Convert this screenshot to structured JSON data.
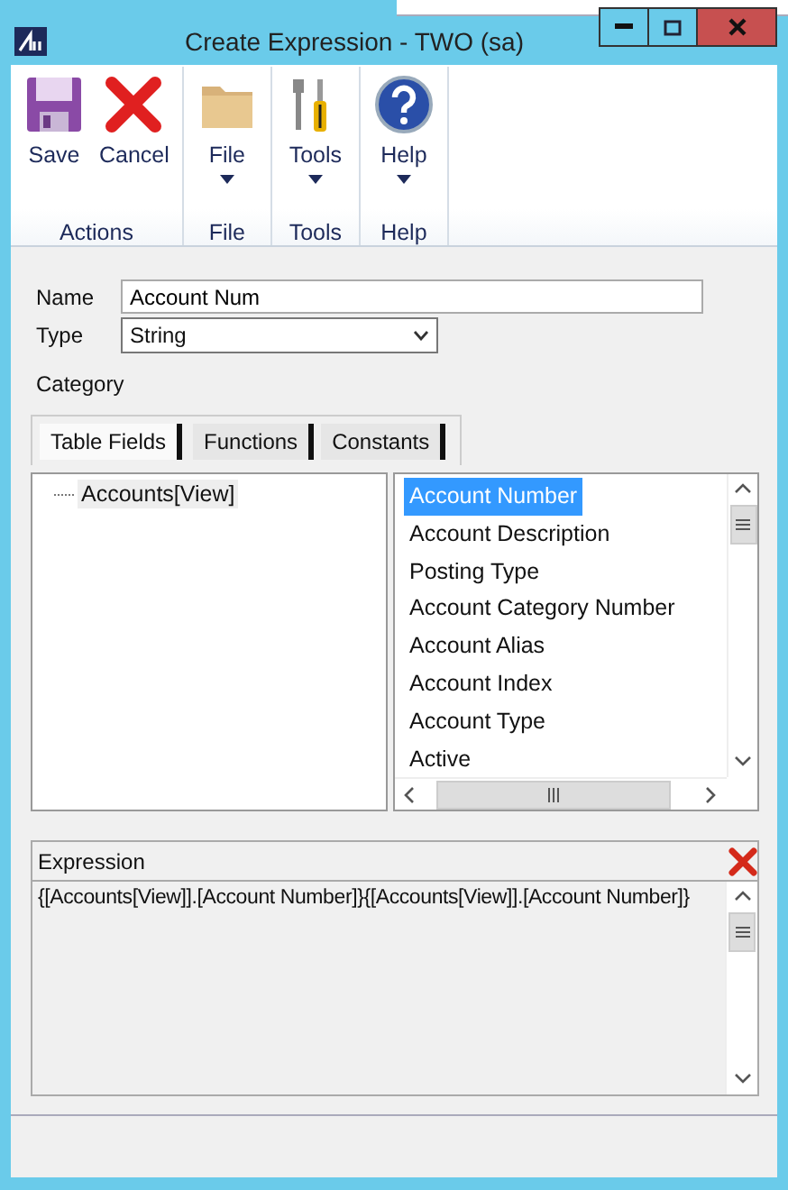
{
  "window": {
    "title": "Create Expression  -  TWO (sa)"
  },
  "ribbon": {
    "groups": [
      {
        "label": "Actions",
        "buttons": [
          {
            "label": "Save",
            "kind": "save",
            "dropdown": false
          },
          {
            "label": "Cancel",
            "kind": "cancel",
            "dropdown": false
          }
        ]
      },
      {
        "label": "File",
        "buttons": [
          {
            "label": "File",
            "kind": "folder",
            "dropdown": true
          }
        ]
      },
      {
        "label": "Tools",
        "buttons": [
          {
            "label": "Tools",
            "kind": "tools",
            "dropdown": true
          }
        ]
      },
      {
        "label": "Help",
        "buttons": [
          {
            "label": "Help",
            "kind": "help",
            "dropdown": true
          }
        ]
      }
    ]
  },
  "form": {
    "name": {
      "label": "Name",
      "value": "Account Num"
    },
    "type": {
      "label": "Type",
      "value": "String"
    },
    "category": {
      "label": "Category"
    }
  },
  "tabs": [
    {
      "label": "Table Fields",
      "selected": true
    },
    {
      "label": "Functions",
      "selected": false
    },
    {
      "label": "Constants",
      "selected": false
    }
  ],
  "tree": {
    "items": [
      {
        "label": "Accounts[View]",
        "selected": true
      }
    ]
  },
  "fields": {
    "items": [
      {
        "label": "Account Number",
        "selected": true
      },
      {
        "label": "Account Description",
        "selected": false
      },
      {
        "label": "Posting Type",
        "selected": false
      },
      {
        "label": "Account Category Number",
        "selected": false
      },
      {
        "label": "Account Alias",
        "selected": false
      },
      {
        "label": "Account Index",
        "selected": false
      },
      {
        "label": "Account Type",
        "selected": false
      },
      {
        "label": "Active",
        "selected": false
      }
    ]
  },
  "expression": {
    "label": "Expression",
    "value": "{[Accounts[View]].[Account Number]}{[Accounts[View]].[Account Number]}"
  }
}
